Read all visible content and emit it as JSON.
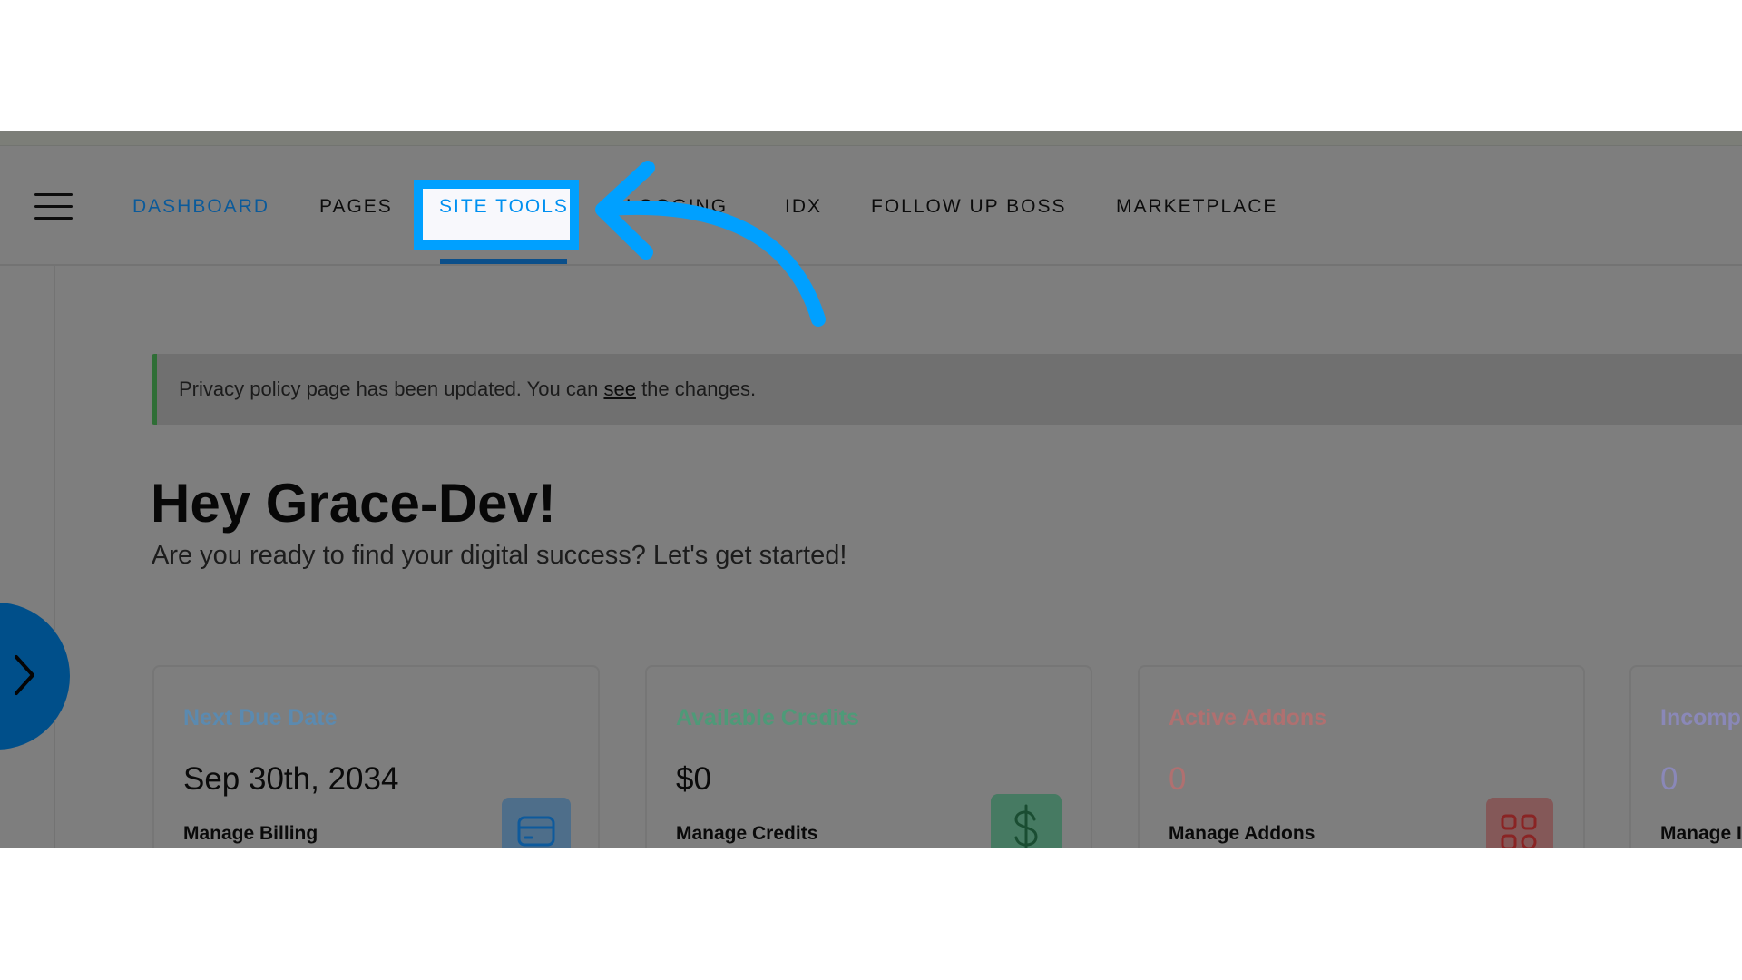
{
  "nav": {
    "menu_icon": "hamburger-icon",
    "items": [
      {
        "label": "DASHBOARD",
        "active": true
      },
      {
        "label": "PAGES",
        "active": false
      },
      {
        "label": "SITE TOOLS",
        "active": false,
        "highlighted": true
      },
      {
        "label": "BLOGGING",
        "active": false
      },
      {
        "label": "IDX",
        "active": false
      },
      {
        "label": "FOLLOW UP BOSS",
        "active": false
      },
      {
        "label": "MARKETPLACE",
        "active": false
      }
    ]
  },
  "banner": {
    "text_before": "Privacy policy page has been updated. You can ",
    "link": "see",
    "text_after": " the changes."
  },
  "greeting": {
    "title": "Hey Grace-Dev!",
    "subtitle": "Are you ready to find your digital success? Let's get started!"
  },
  "side_toggle": {
    "icon": "chevron-right-icon"
  },
  "cards": [
    {
      "title": "Next Due Date",
      "value": "Sep 30th, 2034",
      "link": "Manage Billing",
      "icon": "credit-card-icon",
      "accent": "#5b8ab0"
    },
    {
      "title": "Available Credits",
      "value": "$0",
      "link": "Manage Credits",
      "icon": "dollar-icon",
      "accent": "#4e9a78"
    },
    {
      "title": "Active Addons",
      "value": "0",
      "link": "Manage Addons",
      "icon": "grid-icon",
      "accent": "#b07070"
    },
    {
      "title": "Incomp",
      "value": "0",
      "link": "Manage I",
      "icon": "unknown-icon",
      "accent": "#8a88b8"
    }
  ],
  "annotation": {
    "type": "curved-arrow",
    "color": "#00a0ff",
    "target": "SITE TOOLS"
  }
}
